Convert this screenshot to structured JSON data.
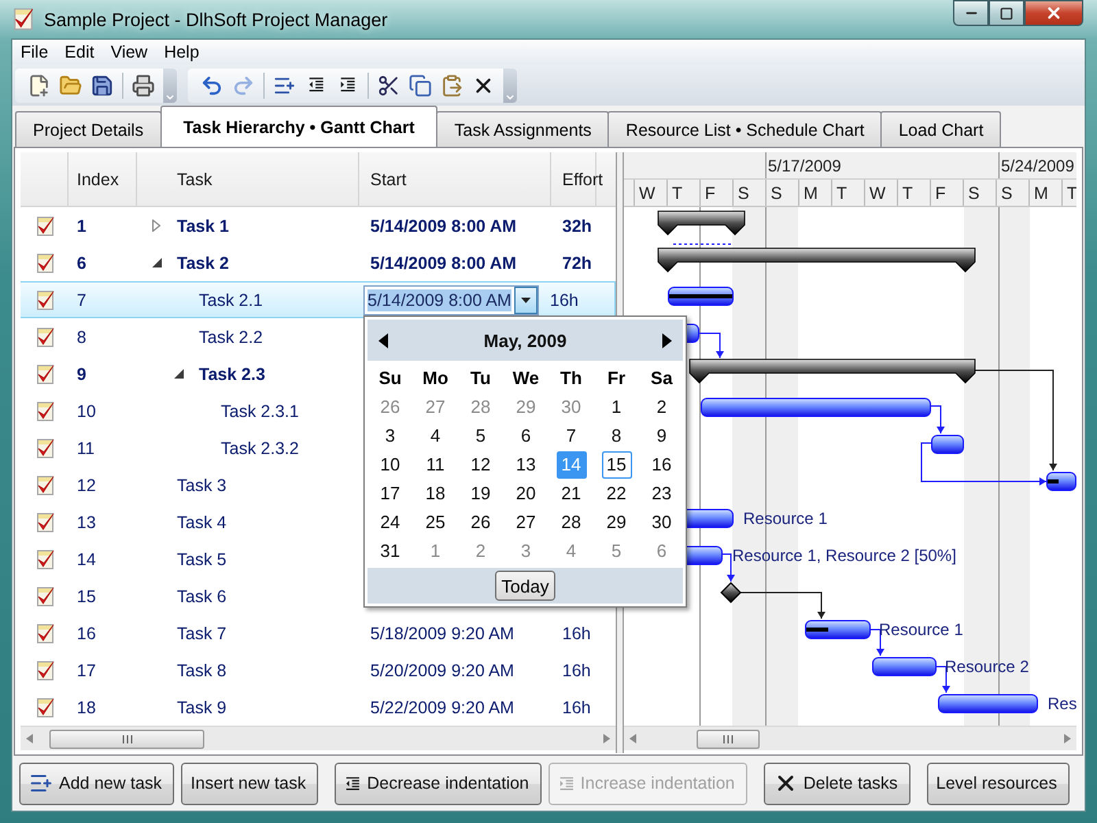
{
  "window": {
    "title": "Sample Project - DlhSoft Project Manager"
  },
  "menu": [
    "File",
    "Edit",
    "View",
    "Help"
  ],
  "toolbars": [
    {
      "groups": [
        [
          {
            "kind": "new",
            "disabled": false
          },
          {
            "kind": "open",
            "disabled": false
          },
          {
            "kind": "save",
            "disabled": false
          }
        ],
        [
          {
            "kind": "print",
            "disabled": false
          }
        ]
      ]
    },
    {
      "groups": [
        [
          {
            "kind": "undo",
            "disabled": false
          },
          {
            "kind": "redo",
            "disabled": true
          }
        ],
        [
          {
            "kind": "add-task",
            "disabled": false
          },
          {
            "kind": "outdent",
            "disabled": false
          },
          {
            "kind": "indent",
            "disabled": false
          }
        ],
        [
          {
            "kind": "cut",
            "disabled": false
          },
          {
            "kind": "copy",
            "disabled": false
          },
          {
            "kind": "paste",
            "disabled": false
          },
          {
            "kind": "delete",
            "disabled": false
          }
        ]
      ]
    }
  ],
  "tabs": [
    {
      "label": "Project Details",
      "selected": false
    },
    {
      "label": "Task Hierarchy • Gantt Chart",
      "selected": true
    },
    {
      "label": "Task Assignments",
      "selected": false
    },
    {
      "label": "Resource List • Schedule Chart",
      "selected": false
    },
    {
      "label": "Load Chart",
      "selected": false
    }
  ],
  "grid": {
    "columns": [
      "Index",
      "Task",
      "Start",
      "Effort"
    ],
    "rows": [
      {
        "checked": true,
        "index": "1",
        "task": "Task 1",
        "start": "5/14/2009 8:00 AM",
        "effort": "32h",
        "expanded": false,
        "selected": false
      },
      {
        "checked": true,
        "index": "6",
        "task": "Task 2",
        "start": "5/14/2009 8:00 AM",
        "effort": "72h",
        "expanded": true,
        "selected": false,
        "children": [
          {
            "checked": true,
            "index": "7",
            "task": "Task 2.1",
            "start": "5/14/2009 8:00 AM",
            "effort": "16h",
            "selected": true
          },
          {
            "checked": true,
            "index": "8",
            "task": "Task 2.2",
            "selected": false
          },
          {
            "checked": true,
            "index": "9",
            "task": "Task 2.3",
            "expanded": true,
            "selected": false,
            "children": [
              {
                "checked": true,
                "index": "10",
                "task": "Task 2.3.1",
                "selected": false
              },
              {
                "checked": true,
                "index": "11",
                "task": "Task 2.3.2",
                "selected": false
              }
            ]
          }
        ]
      },
      {
        "checked": true,
        "index": "12",
        "task": "Task 3",
        "selected": false
      },
      {
        "checked": true,
        "index": "13",
        "task": "Task 4",
        "selected": false
      },
      {
        "checked": true,
        "index": "14",
        "task": "Task 5",
        "selected": false
      },
      {
        "checked": true,
        "index": "15",
        "task": "Task 6",
        "selected": false
      },
      {
        "checked": true,
        "index": "16",
        "task": "Task 7",
        "start": "5/18/2009 9:20 AM",
        "effort": "16h",
        "selected": false
      },
      {
        "checked": true,
        "index": "17",
        "task": "Task 8",
        "start": "5/20/2009 9:20 AM",
        "effort": "16h",
        "selected": false
      },
      {
        "checked": true,
        "index": "18",
        "task": "Task 9",
        "start": "5/22/2009 9:20 AM",
        "effort": "16h",
        "selected": false
      }
    ]
  },
  "gantt": {
    "weeks": [
      "5/17/2009",
      "5/24/2009"
    ],
    "days": [
      "W",
      "T",
      "F",
      "S",
      "S",
      "M",
      "T",
      "W",
      "T",
      "F",
      "S",
      "S",
      "M",
      "T"
    ],
    "labels": [
      "Resource 1",
      "Resource 1, Resource 2 [50%]",
      "Resource 1",
      "Resource 2",
      "Res"
    ]
  },
  "date_picker": {
    "title": "May, 2009",
    "weekdays": [
      "Su",
      "Mo",
      "Tu",
      "We",
      "Th",
      "Fr",
      "Sa"
    ],
    "today_button": "Today",
    "days": [
      {
        "label": "26",
        "outside": true,
        "selected": false,
        "today": false
      },
      {
        "label": "27",
        "outside": true,
        "selected": false,
        "today": false
      },
      {
        "label": "28",
        "outside": true,
        "selected": false,
        "today": false
      },
      {
        "label": "29",
        "outside": true,
        "selected": false,
        "today": false
      },
      {
        "label": "30",
        "outside": true,
        "selected": false,
        "today": false
      },
      {
        "label": "1",
        "outside": false,
        "selected": false,
        "today": false
      },
      {
        "label": "2",
        "outside": false,
        "selected": false,
        "today": false
      },
      {
        "label": "3",
        "outside": false,
        "selected": false,
        "today": false
      },
      {
        "label": "4",
        "outside": false,
        "selected": false,
        "today": false
      },
      {
        "label": "5",
        "outside": false,
        "selected": false,
        "today": false
      },
      {
        "label": "6",
        "outside": false,
        "selected": false,
        "today": false
      },
      {
        "label": "7",
        "outside": false,
        "selected": false,
        "today": false
      },
      {
        "label": "8",
        "outside": false,
        "selected": false,
        "today": false
      },
      {
        "label": "9",
        "outside": false,
        "selected": false,
        "today": false
      },
      {
        "label": "10",
        "outside": false,
        "selected": false,
        "today": false
      },
      {
        "label": "11",
        "outside": false,
        "selected": false,
        "today": false
      },
      {
        "label": "12",
        "outside": false,
        "selected": false,
        "today": false
      },
      {
        "label": "13",
        "outside": false,
        "selected": false,
        "today": false
      },
      {
        "label": "14",
        "outside": false,
        "selected": true,
        "today": false
      },
      {
        "label": "15",
        "outside": false,
        "selected": false,
        "today": true
      },
      {
        "label": "16",
        "outside": false,
        "selected": false,
        "today": false
      },
      {
        "label": "17",
        "outside": false,
        "selected": false,
        "today": false
      },
      {
        "label": "18",
        "outside": false,
        "selected": false,
        "today": false
      },
      {
        "label": "19",
        "outside": false,
        "selected": false,
        "today": false
      },
      {
        "label": "20",
        "outside": false,
        "selected": false,
        "today": false
      },
      {
        "label": "21",
        "outside": false,
        "selected": false,
        "today": false
      },
      {
        "label": "22",
        "outside": false,
        "selected": false,
        "today": false
      },
      {
        "label": "23",
        "outside": false,
        "selected": false,
        "today": false
      },
      {
        "label": "24",
        "outside": false,
        "selected": false,
        "today": false
      },
      {
        "label": "25",
        "outside": false,
        "selected": false,
        "today": false
      },
      {
        "label": "26",
        "outside": false,
        "selected": false,
        "today": false
      },
      {
        "label": "27",
        "outside": false,
        "selected": false,
        "today": false
      },
      {
        "label": "28",
        "outside": false,
        "selected": false,
        "today": false
      },
      {
        "label": "29",
        "outside": false,
        "selected": false,
        "today": false
      },
      {
        "label": "30",
        "outside": false,
        "selected": false,
        "today": false
      },
      {
        "label": "31",
        "outside": false,
        "selected": false,
        "today": false
      },
      {
        "label": "1",
        "outside": true,
        "selected": false,
        "today": false
      },
      {
        "label": "2",
        "outside": true,
        "selected": false,
        "today": false
      },
      {
        "label": "3",
        "outside": true,
        "selected": false,
        "today": false
      },
      {
        "label": "4",
        "outside": true,
        "selected": false,
        "today": false
      },
      {
        "label": "5",
        "outside": true,
        "selected": false,
        "today": false
      },
      {
        "label": "6",
        "outside": true,
        "selected": false,
        "today": false
      }
    ]
  },
  "buttons": [
    [
      {
        "label": "Add new task",
        "kind": "add-task",
        "disabled": false
      },
      {
        "label": "Insert new task",
        "kind": "plain",
        "disabled": false
      }
    ],
    [
      {
        "label": "Decrease indentation",
        "kind": "outdent",
        "disabled": false
      },
      {
        "label": "Increase indentation",
        "kind": "indent",
        "disabled": true
      }
    ],
    [
      {
        "label": "Delete tasks",
        "kind": "delete",
        "disabled": false
      }
    ],
    [
      {
        "label": "Level resources",
        "kind": "plain",
        "disabled": false
      }
    ]
  ]
}
